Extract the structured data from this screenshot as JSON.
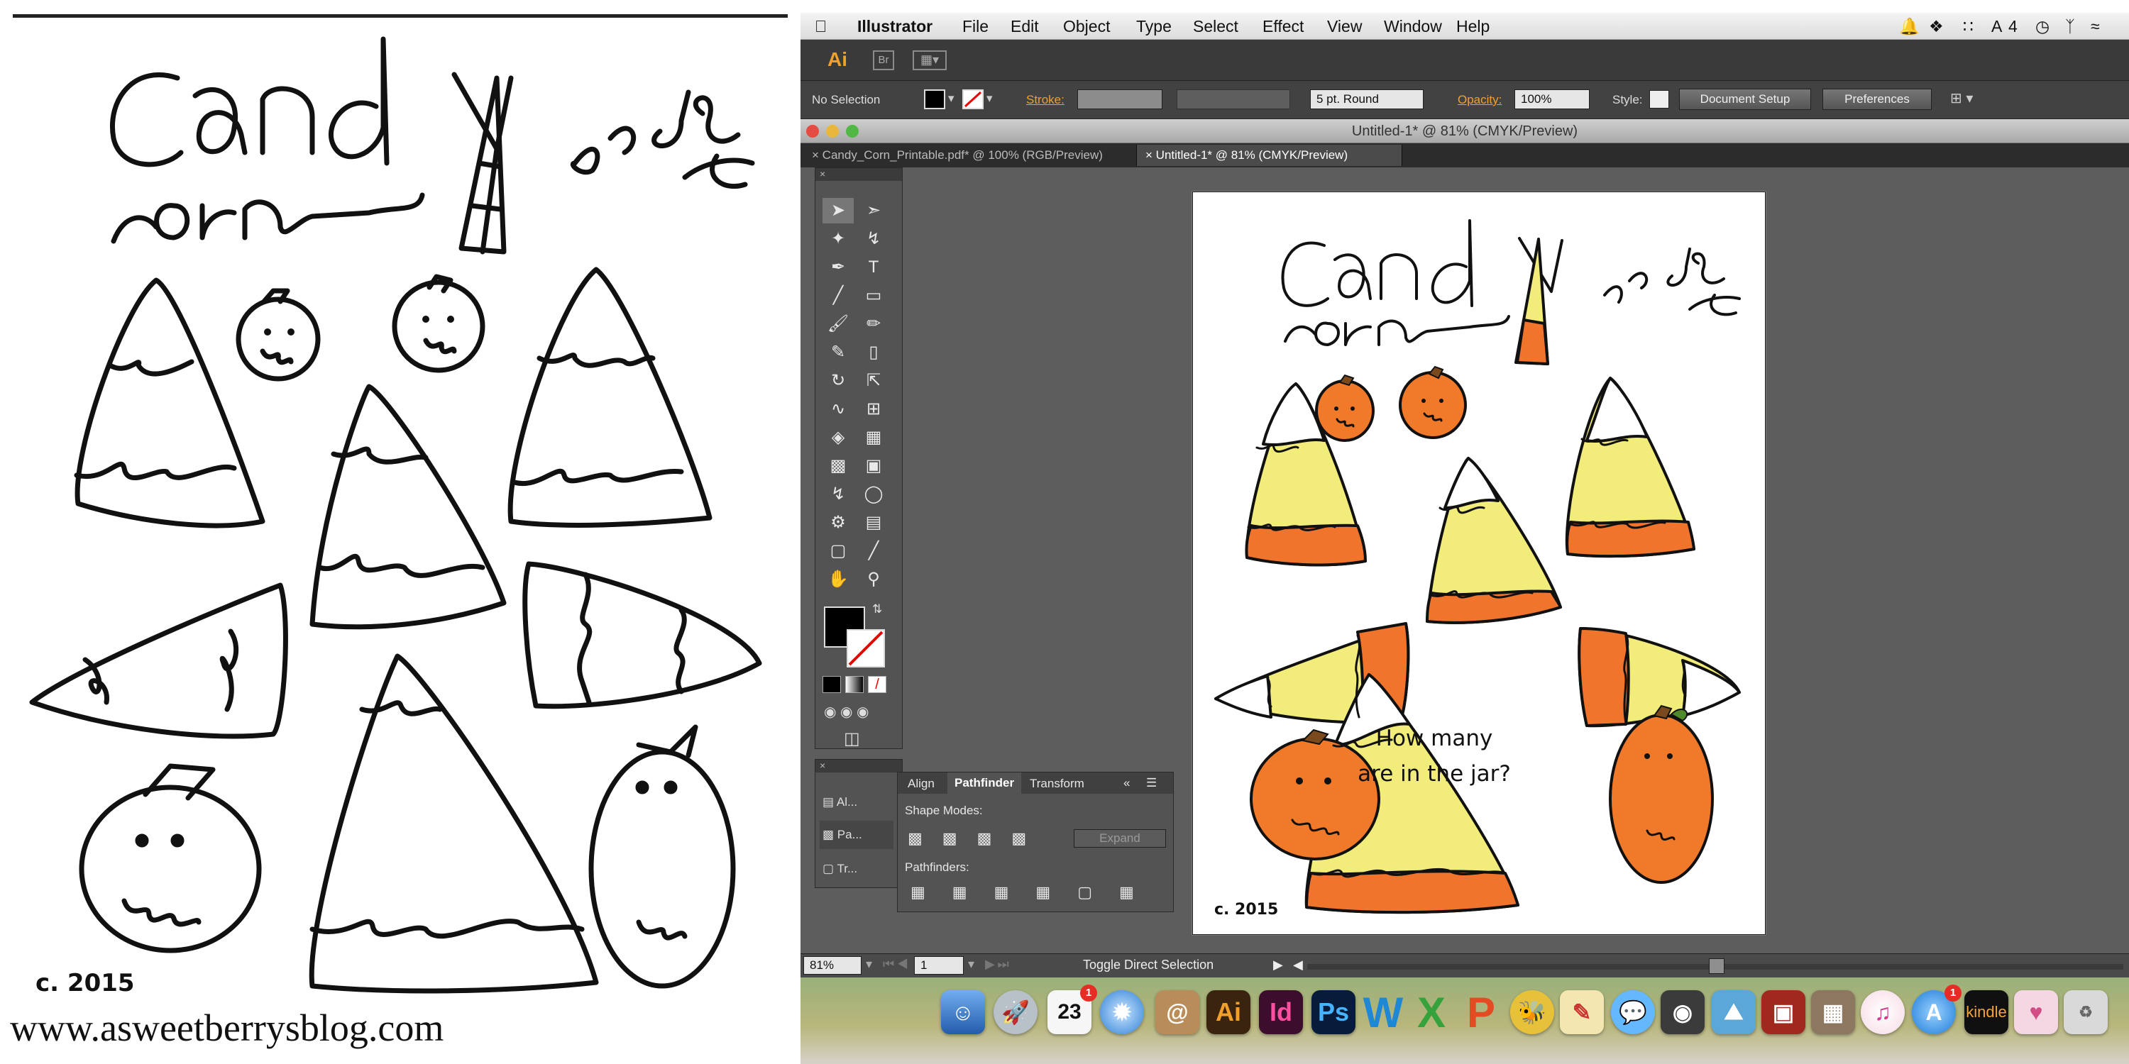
{
  "left_sheet": {
    "title": "Candy corn",
    "byline": "by Laura Kelley",
    "copyright": "c. 2015",
    "website": "www.asweetberrysblog.com"
  },
  "mac_menu": {
    "apple": "",
    "items": [
      "Illustrator",
      "File",
      "Edit",
      "Object",
      "Type",
      "Select",
      "Effect",
      "View",
      "Window",
      "Help"
    ],
    "status": "4"
  },
  "app_bar": {
    "ai": "Ai",
    "br": "Br"
  },
  "control_bar": {
    "selection": "No Selection",
    "stroke_label": "Stroke:",
    "brush": "5 pt. Round",
    "opacity_label": "Opacity:",
    "opacity_value": "100%",
    "style_label": "Style:",
    "document_setup": "Document Setup",
    "preferences": "Preferences"
  },
  "window_title": "Untitled-1* @ 81% (CMYK/Preview)",
  "tabs": [
    {
      "label": "Candy_Corn_Printable.pdf* @ 100% (RGB/Preview)"
    },
    {
      "label": "Untitled-1* @ 81% (CMYK/Preview)"
    }
  ],
  "side_panel": {
    "items": [
      "Al...",
      "Pa...",
      "Tr..."
    ]
  },
  "pathfinder_panel": {
    "tabs": [
      "Align",
      "Pathfinder",
      "Transform"
    ],
    "shape_modes": "Shape Modes:",
    "expand": "Expand",
    "pathfinders": "Pathfinders:"
  },
  "artboard": {
    "title": "Candy corn",
    "byline": "by Laura Kelley",
    "question": "How many are in the jar?",
    "copyright": "c. 2015"
  },
  "status_bar": {
    "zoom": "81%",
    "page": "1",
    "tool": "Toggle Direct Selection"
  },
  "dock": {
    "calendar_day": "23",
    "calendar_badge": "1",
    "appstore_badge": "1",
    "kindle": "kindle"
  },
  "colors": {
    "candy_orange": "#f0742b",
    "candy_yellow": "#f2ec7a",
    "pumpkin": "#f07a2a",
    "ui_orange": "#f1a12b"
  }
}
